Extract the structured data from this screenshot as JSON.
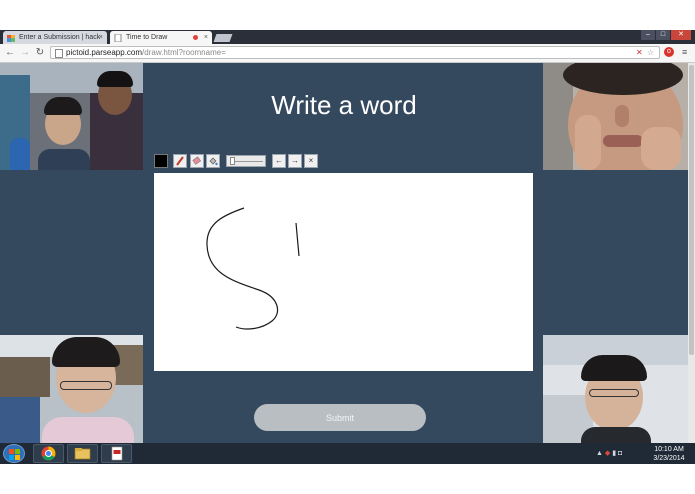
{
  "browser": {
    "tabs": [
      {
        "title": "Enter a Submission | hack",
        "active": false
      },
      {
        "title": "Time to Draw",
        "active": true
      }
    ],
    "url_host": "pictoid.parseapp.com",
    "url_path": "/draw.html?roomname=",
    "window_buttons": [
      "–",
      "□",
      "✕"
    ]
  },
  "page": {
    "heading": "Write a word",
    "tools": {
      "current_color": "#000000",
      "brush_icon": "brush-icon",
      "eraser_icon": "eraser-icon",
      "fill_icon": "fill-bucket-icon",
      "undo_label": "←",
      "redo_label": "→",
      "clear_label": "×"
    },
    "submit_label": "Submit",
    "colors": {
      "background": "#34495e",
      "button": "#b9bec3"
    }
  },
  "taskbar": {
    "clock_time": "10:10 AM",
    "clock_date": "3/23/2014",
    "apps": [
      "chrome-icon",
      "file-explorer-icon",
      "pdf-app-icon"
    ]
  }
}
